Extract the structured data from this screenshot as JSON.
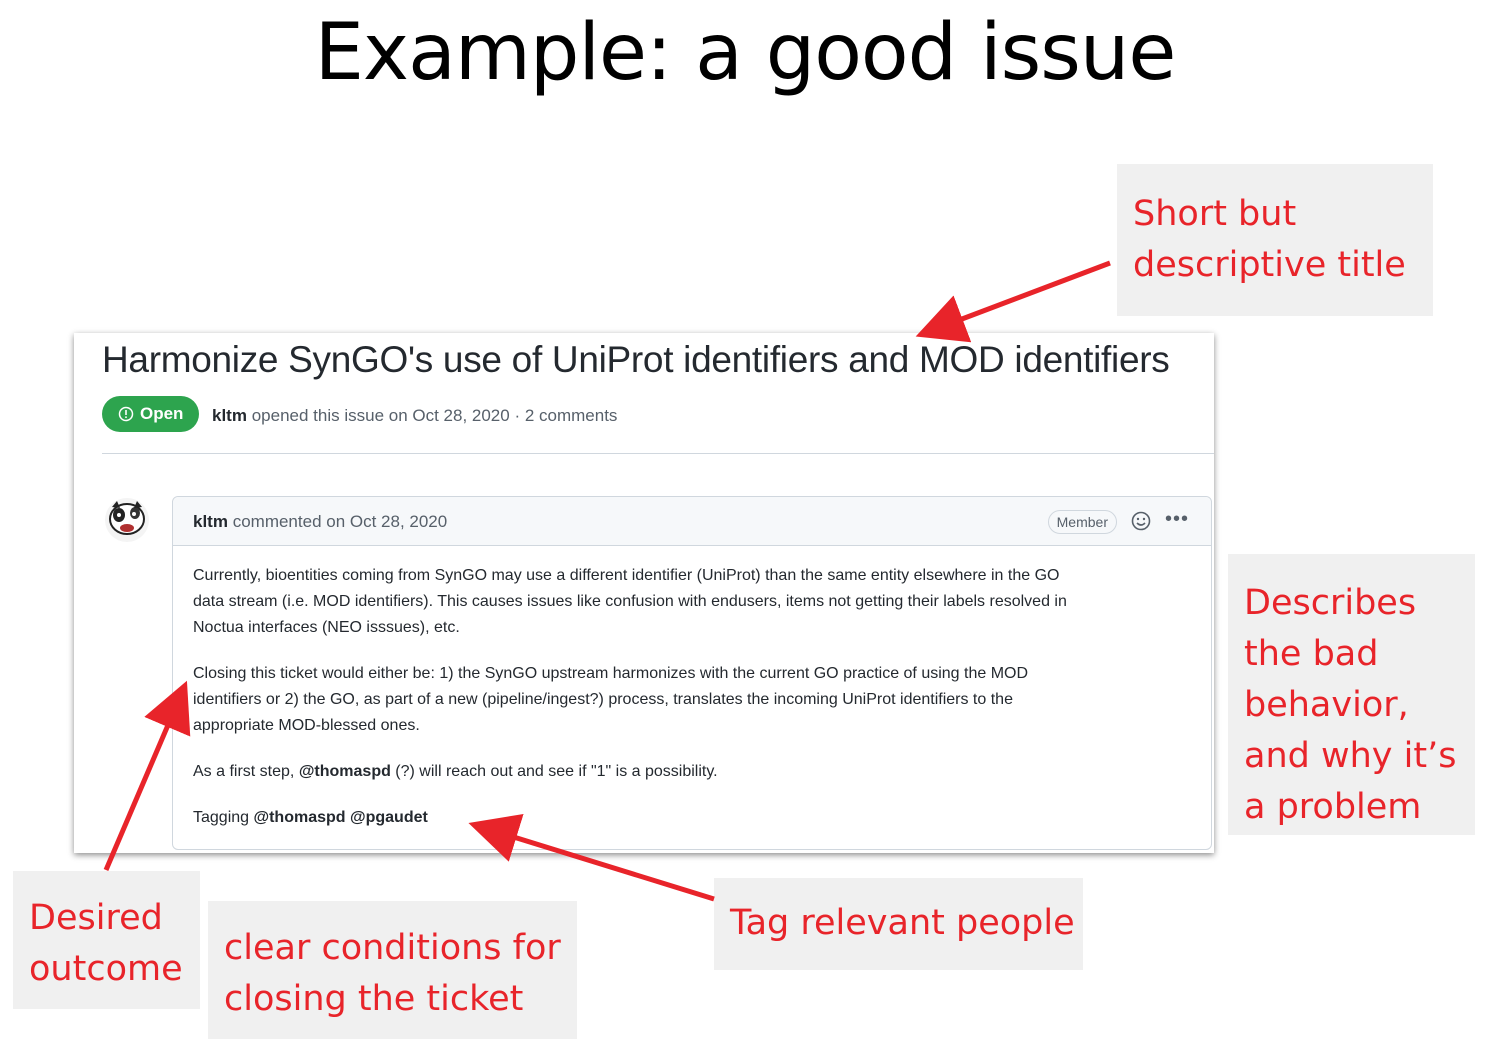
{
  "slide": {
    "title": "Example: a good issue"
  },
  "issue": {
    "title": "Harmonize SynGO's use of UniProt identifiers and MOD identifiers",
    "status": "Open",
    "author": "kltm",
    "opened_text": "opened this issue on Oct 28, 2020 · 2 comments"
  },
  "comment": {
    "author": "kltm",
    "date_text": "commented on Oct 28, 2020",
    "role_badge": "Member",
    "icons": [
      "avatar",
      "smiley-icon",
      "kebab-menu-icon",
      "open-status-icon"
    ],
    "paragraph1": [
      "Currently, bioentities coming from SynGO may use a different identifier (UniProt) than the same entity elsewhere in the GO",
      "data stream (i.e. MOD identifiers). This causes issues like confusion with endusers, items not getting their labels resolved in",
      "Noctua interfaces (NEO isssues), etc."
    ],
    "paragraph2": [
      "Closing this ticket would either be: 1) the SynGO upstream harmonizes with the current GO practice of using the MOD",
      "identifiers or 2) the GO, as part of a new (pipeline/ingest?) process, translates the incoming UniProt identifiers to the",
      "appropriate MOD-blessed ones."
    ],
    "paragraph3": {
      "before": "As a first step, ",
      "mention": "@thomaspd",
      "after": " (?) will reach out and see if \"1\" is a possibility."
    },
    "paragraph4": {
      "before": "Tagging ",
      "mention1": "@thomaspd",
      "mention2": "@pgaudet"
    }
  },
  "callouts": {
    "title_note": [
      "Short but",
      "descriptive title"
    ],
    "behavior_note": [
      "Describes",
      "the bad",
      "behavior,",
      "and why it’s",
      "a problem"
    ],
    "outcome_note": [
      "Desired",
      "outcome"
    ],
    "closing_note": [
      "clear conditions for",
      "closing the ticket"
    ],
    "tag_note": [
      "Tag relevant people"
    ]
  },
  "colors": {
    "accent_red": "#e8242a",
    "callout_bg": "#f0f0f0",
    "open_green": "#2da44e"
  }
}
